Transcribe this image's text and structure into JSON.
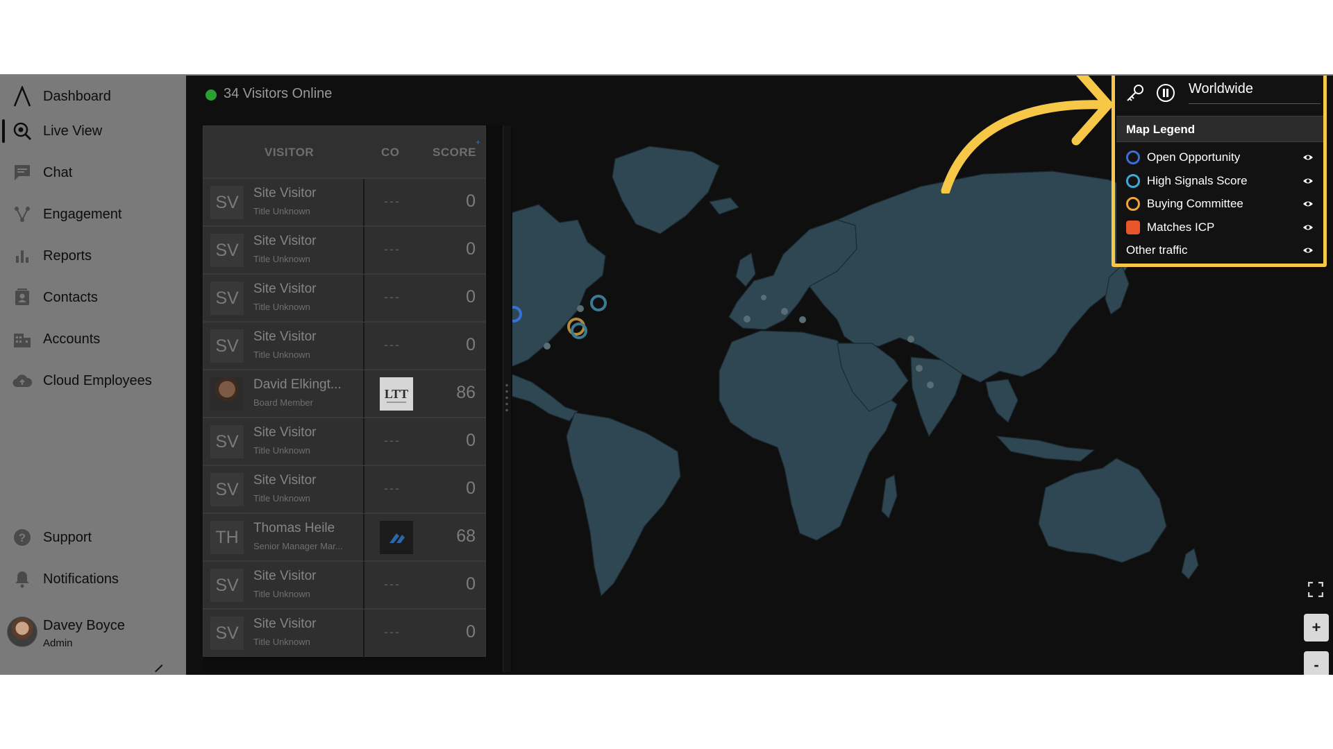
{
  "sidebar": {
    "items": [
      {
        "label": "Dashboard",
        "icon": "logo-icon"
      },
      {
        "label": "Live View",
        "icon": "live-view-icon"
      },
      {
        "label": "Chat",
        "icon": "chat-icon"
      },
      {
        "label": "Engagement",
        "icon": "engagement-icon"
      },
      {
        "label": "Reports",
        "icon": "bar-chart-icon"
      },
      {
        "label": "Contacts",
        "icon": "contacts-icon"
      },
      {
        "label": "Accounts",
        "icon": "building-icon"
      },
      {
        "label": "Cloud Employees",
        "icon": "cloud-icon"
      }
    ],
    "bottom_items": [
      {
        "label": "Support",
        "icon": "help-icon"
      },
      {
        "label": "Notifications",
        "icon": "bell-icon"
      }
    ],
    "user": {
      "name": "Davey Boyce",
      "role": "Admin"
    }
  },
  "header": {
    "online_text": "34 Visitors Online",
    "online_color": "#2aa132"
  },
  "visitor_table": {
    "columns": [
      "VISITOR",
      "CO",
      "SCORE"
    ],
    "rows": [
      {
        "initials": "SV",
        "name": "Site Visitor",
        "title": "Title Unknown",
        "co": "---",
        "score": "0"
      },
      {
        "initials": "SV",
        "name": "Site Visitor",
        "title": "Title Unknown",
        "co": "---",
        "score": "0"
      },
      {
        "initials": "SV",
        "name": "Site Visitor",
        "title": "Title Unknown",
        "co": "---",
        "score": "0"
      },
      {
        "initials": "SV",
        "name": "Site Visitor",
        "title": "Title Unknown",
        "co": "---",
        "score": "0"
      },
      {
        "initials": "",
        "name": "David Elkingt...",
        "title": "Board Member",
        "co": "LTT",
        "score": "86",
        "photo": true
      },
      {
        "initials": "SV",
        "name": "Site Visitor",
        "title": "Title Unknown",
        "co": "---",
        "score": "0"
      },
      {
        "initials": "SV",
        "name": "Site Visitor",
        "title": "Title Unknown",
        "co": "---",
        "score": "0"
      },
      {
        "initials": "TH",
        "name": "Thomas Heile",
        "title": "Senior Manager Mar...",
        "co": "company-logo",
        "score": "68"
      },
      {
        "initials": "SV",
        "name": "Site Visitor",
        "title": "Title Unknown",
        "co": "---",
        "score": "0"
      },
      {
        "initials": "SV",
        "name": "Site Visitor",
        "title": "Title Unknown",
        "co": "---",
        "score": "0"
      }
    ]
  },
  "legend": {
    "region": "Worldwide",
    "title": "Map Legend",
    "items": [
      {
        "label": "Open Opportunity",
        "color": "#3a6fd8"
      },
      {
        "label": "High Signals Score",
        "color": "#3fa9d8"
      },
      {
        "label": "Buying Committee",
        "color": "#f0a53a"
      },
      {
        "label": "Matches ICP",
        "color": "#e8562a"
      },
      {
        "label": "Other traffic",
        "color": ""
      }
    ],
    "highlight_color": "#f7c848"
  },
  "map_controls": {
    "zoom_in": "+",
    "zoom_out": "-"
  }
}
